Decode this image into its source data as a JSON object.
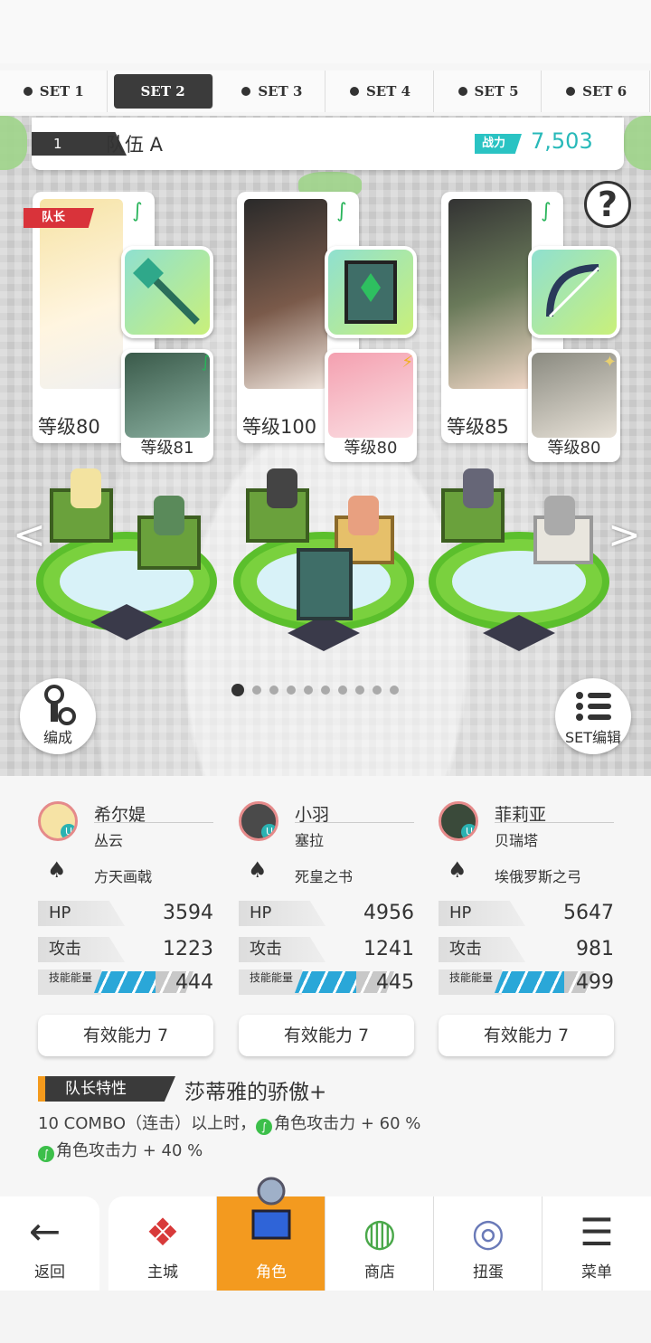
{
  "set_tabs": [
    {
      "label": "SET 1"
    },
    {
      "label": "SET 2",
      "active": true
    },
    {
      "label": "SET 3"
    },
    {
      "label": "SET 4"
    },
    {
      "label": "SET 5"
    },
    {
      "label": "SET 6"
    }
  ],
  "team": {
    "number": "1",
    "name": "队伍 A",
    "power_label": "战力",
    "power_value": "7,503"
  },
  "help_label": "?",
  "leader_ribbon": "队长",
  "cards": [
    {
      "main_level": "等级80",
      "sub_level": "等级81",
      "sub_element": "leaf"
    },
    {
      "main_level": "等级100",
      "sub_level": "等级80",
      "sub_element": "lightning"
    },
    {
      "main_level": "等级85",
      "sub_level": "等级80",
      "sub_element": "star"
    }
  ],
  "pager": {
    "count": 10,
    "active": 0
  },
  "buttons": {
    "formation": "编成",
    "set_edit": "SET编辑"
  },
  "characters": [
    {
      "name": "希尔媞",
      "title": "丛云",
      "weapon": "方天画戟",
      "hp_label": "HP",
      "hp": "3594",
      "atk_label": "攻击",
      "atk": "1223",
      "energy_label": "技能能量",
      "energy": "444",
      "energy_fill": 0.62,
      "effective": "有效能力 7"
    },
    {
      "name": "小羽",
      "title": "塞拉",
      "weapon": "死皇之书",
      "hp_label": "HP",
      "hp": "4956",
      "atk_label": "攻击",
      "atk": "1241",
      "energy_label": "技能能量",
      "energy": "445",
      "energy_fill": 0.62,
      "effective": "有效能力 7"
    },
    {
      "name": "菲莉亚",
      "title": "贝瑞塔",
      "weapon": "埃俄罗斯之弓",
      "hp_label": "HP",
      "hp": "5647",
      "atk_label": "攻击",
      "atk": "981",
      "energy_label": "技能能量",
      "energy": "499",
      "energy_fill": 0.7,
      "effective": "有效能力 7"
    }
  ],
  "leader_skill": {
    "tag": "队长特性",
    "title": "莎蒂雅的骄傲+",
    "line1": "10 COMBO（连击）以上时，",
    "line1b": "角色攻击力 + 60 %",
    "line2": "角色攻击力 + 40 %"
  },
  "nav": {
    "back": "返回",
    "items": [
      "主城",
      "角色",
      "商店",
      "扭蛋",
      "菜单"
    ],
    "active": 1
  },
  "colors": {
    "accent": "#f39a1f",
    "teal": "#2ac3c3",
    "energy": "#2aa7d8"
  }
}
